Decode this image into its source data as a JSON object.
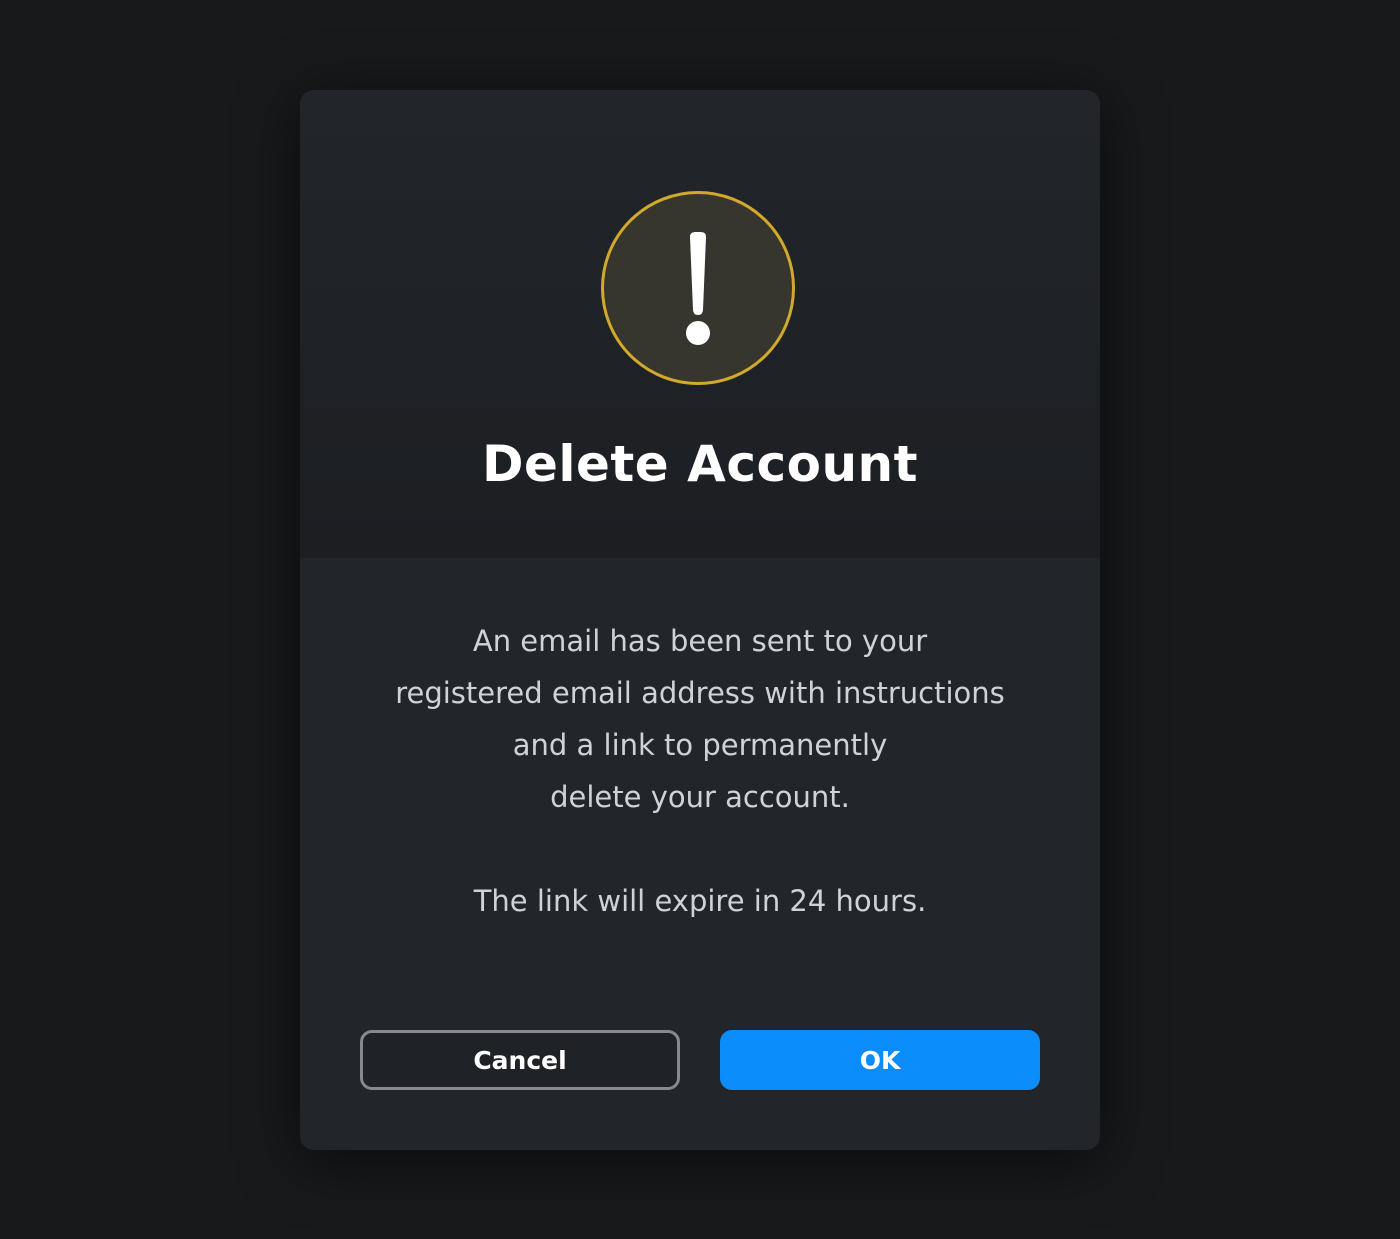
{
  "dialog": {
    "icon": "warning-exclamation-icon",
    "accent_color": "#d2a92a",
    "title": "Delete Account",
    "message_lines": [
      "An email has been sent to your",
      "registered email address with instructions",
      "and a link to permanently",
      "delete your account."
    ],
    "expiry_note": "The link will expire in 24 hours.",
    "cancel_label": "Cancel",
    "ok_label": "OK",
    "ok_color": "#0a8dfa"
  }
}
